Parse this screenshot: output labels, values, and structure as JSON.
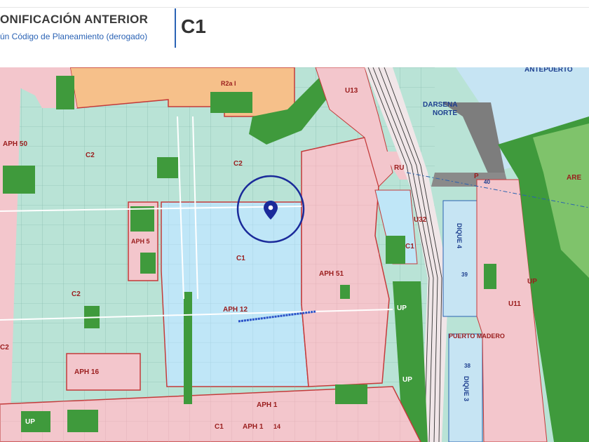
{
  "header": {
    "title": "ONIFICACIÓN ANTERIOR",
    "subtitle": "ún Código de Planeamiento (derogado)",
    "zone_code": "C1"
  },
  "map": {
    "zones": {
      "aph50": "APH 50",
      "c2_north": "C2",
      "c2_west": "C2",
      "c2_left": "C2",
      "r2a": "R2a I",
      "u13": "U13",
      "ru": "RU",
      "u32": "U32",
      "aph5": "APH 5",
      "aph51": "APH 51",
      "aph12": "APH 12",
      "c1_main": "C1",
      "c1_east": "C1",
      "c1_bottom": "C1",
      "aph16": "APH 16",
      "aph1": "APH 1",
      "aph1_14": "APH 1",
      "num14": "14",
      "up_south": "UP",
      "up_mid": "UP",
      "up_right": "UP",
      "up_left": "UP",
      "u11": "U11",
      "p": "P",
      "are": "ARE"
    },
    "places": {
      "antepuerto": "ANTEPUERTO",
      "darsena_1": "DARSENA",
      "darsena_2": "NORTE",
      "dique4": "DIQUE 4",
      "dique3": "DIQUE 3",
      "puerto_madero": "PUERTO MADERO",
      "n39": "39",
      "n38": "38",
      "n40": "40"
    },
    "colors": {
      "c2_zone": "#b9e3d6",
      "c1_zone": "#bfe6f7",
      "aph_zone": "#f3c6cc",
      "residential": "#f6c08a",
      "green_space": "#3f9a3c",
      "water": "#c6e4f3",
      "marker": "#1a2a9a"
    }
  }
}
